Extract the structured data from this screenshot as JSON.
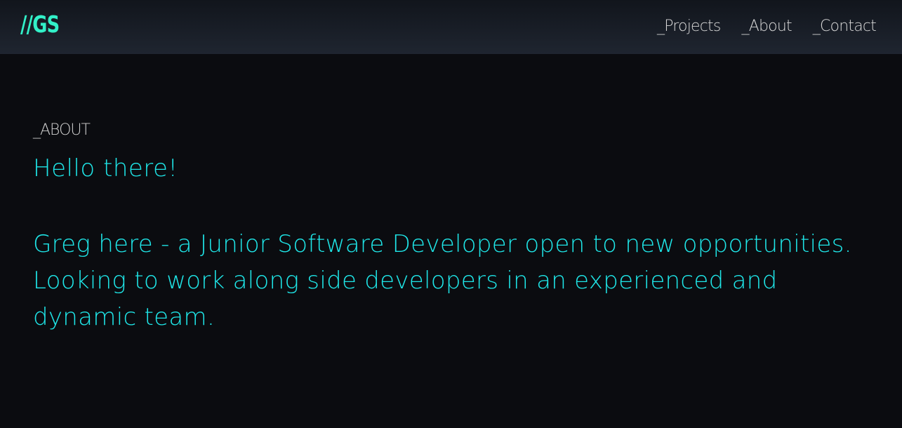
{
  "header": {
    "logo_text": "//GS",
    "nav": [
      {
        "label": "_Projects"
      },
      {
        "label": "_About"
      },
      {
        "label": "_Contact"
      }
    ]
  },
  "about": {
    "section_label": "_ABOUT",
    "greeting": "Hello there!",
    "intro": "Greg here - a Junior Software Developer open to new opportunities. Looking to work along side developers in an experienced and dynamic team."
  },
  "colors": {
    "background": "#0b0c10",
    "header_background": "#1f2530",
    "logo_accent": "#32f0c8",
    "text_accent": "#1fe6e8",
    "nav_text": "#d8d8d8"
  }
}
